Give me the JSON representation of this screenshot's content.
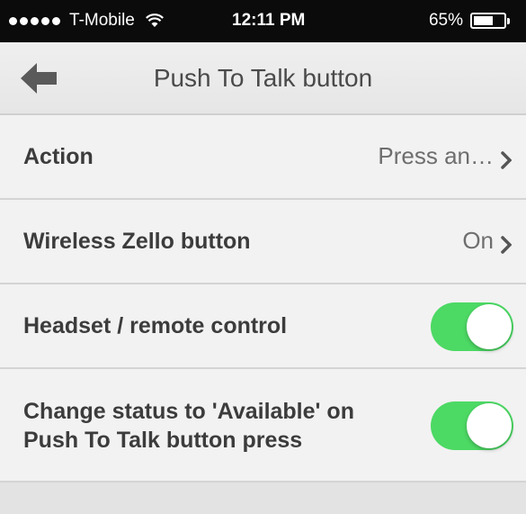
{
  "status_bar": {
    "carrier": "T-Mobile",
    "time": "12:11 PM",
    "battery_percent": "65%",
    "battery_level": 0.65,
    "icons": [
      "signal-dots-icon",
      "wifi-icon",
      "battery-icon"
    ]
  },
  "header": {
    "title": "Push To Talk button",
    "back_icon": "back-arrow-icon"
  },
  "settings": [
    {
      "label": "Action",
      "value": "Press an…",
      "control": "disclosure"
    },
    {
      "label": "Wireless Zello button",
      "value": "On",
      "control": "disclosure"
    },
    {
      "label": "Headset / remote control",
      "control": "toggle",
      "on": true
    },
    {
      "label_lines": [
        "Change status to 'Available' on",
        "Push To Talk button press"
      ],
      "control": "toggle",
      "on": true
    }
  ],
  "colors": {
    "toggle_on": "#4cd964",
    "status_bar_bg": "#0b0b0b",
    "row_bg": "#f2f2f2"
  }
}
